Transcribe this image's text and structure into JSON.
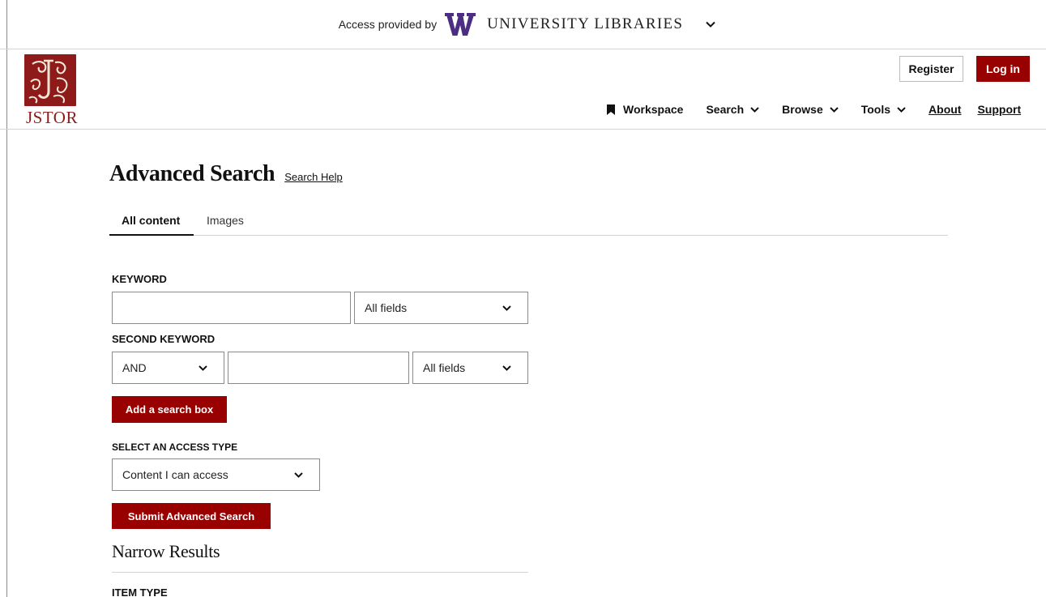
{
  "access_bar": {
    "prefix": "Access provided by",
    "institution": "UNIVERSITY LIBRARIES",
    "logo_icon": "uw-w-logo",
    "brand_color": "#4b2e83"
  },
  "header": {
    "logo_text": "JSTOR",
    "brand_color": "#990000",
    "register_label": "Register",
    "login_label": "Log in",
    "nav": {
      "workspace": "Workspace",
      "search": "Search",
      "browse": "Browse",
      "tools": "Tools",
      "about": "About",
      "support": "Support"
    }
  },
  "main": {
    "title": "Advanced Search",
    "help_link": "Search Help",
    "tabs": [
      {
        "label": "All content",
        "active": true
      },
      {
        "label": "Images",
        "active": false
      }
    ],
    "keyword": {
      "label": "KEYWORD",
      "value": "",
      "field_select": "All fields"
    },
    "second_keyword": {
      "label": "SECOND KEYWORD",
      "operator": "AND",
      "value": "",
      "field_select": "All fields"
    },
    "add_box_label": "Add a search box",
    "access_type": {
      "label": "SELECT AN ACCESS TYPE",
      "value": "Content I can access"
    },
    "submit_label": "Submit Advanced Search",
    "narrow_title": "Narrow Results",
    "item_type_label": "ITEM TYPE"
  }
}
